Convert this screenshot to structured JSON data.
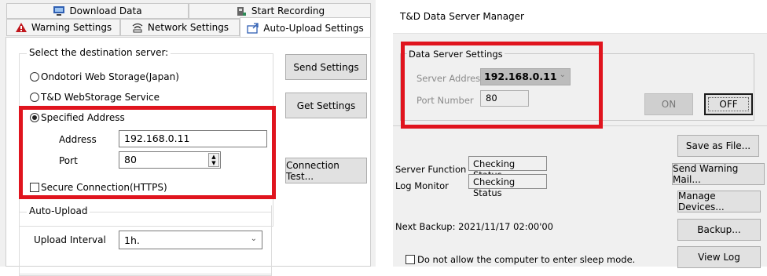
{
  "left": {
    "tabs_top": [
      {
        "label": "Download Data",
        "icon": "download-data-icon"
      },
      {
        "label": "Start Recording",
        "icon": "start-recording-icon"
      }
    ],
    "tabs_bottom": [
      {
        "label": "Warning Settings",
        "icon": "warning-icon"
      },
      {
        "label": "Network Settings",
        "icon": "network-icon"
      },
      {
        "label": "Auto-Upload Settings",
        "icon": "auto-upload-icon"
      }
    ],
    "destination": {
      "legend": "Select the destination server:",
      "options": [
        "Ondotori Web Storage(Japan)",
        "T&D WebStorage Service",
        "Specified Address"
      ],
      "selected": "Specified Address",
      "address_label": "Address",
      "address_value": "192.168.0.11",
      "port_label": "Port",
      "port_value": "80",
      "secure_label": "Secure Connection(HTTPS)"
    },
    "buttons": {
      "send": "Send Settings",
      "get": "Get Settings",
      "test": "Connection Test..."
    },
    "auto_upload": {
      "legend": "Auto-Upload",
      "interval_label": "Upload Interval",
      "interval_value": "1h."
    }
  },
  "right": {
    "title": "T&D Data Server Manager",
    "settings": {
      "legend": "Data Server Settings",
      "server_address_label": "Server Address",
      "server_address_value": "192.168.0.11",
      "port_label": "Port Number",
      "port_value": "80"
    },
    "on_label": "ON",
    "off_label": "OFF",
    "save_label": "Save as File...",
    "server_function_label": "Server Function",
    "server_function_value": "Checking Status",
    "log_monitor_label": "Log Monitor",
    "log_monitor_value": "Checking Status",
    "send_warning_label": "Send Warning Mail...",
    "manage_devices_label": "Manage Devices...",
    "next_backup_label": "Next Backup: 2021/11/17 02:00'00",
    "backup_label": "Backup...",
    "sleep_label": "Do not allow the computer to enter sleep mode.",
    "view_log_label": "View Log"
  },
  "colors": {
    "highlight": "#e0141e",
    "panel_bg": "#f0f0f0"
  }
}
